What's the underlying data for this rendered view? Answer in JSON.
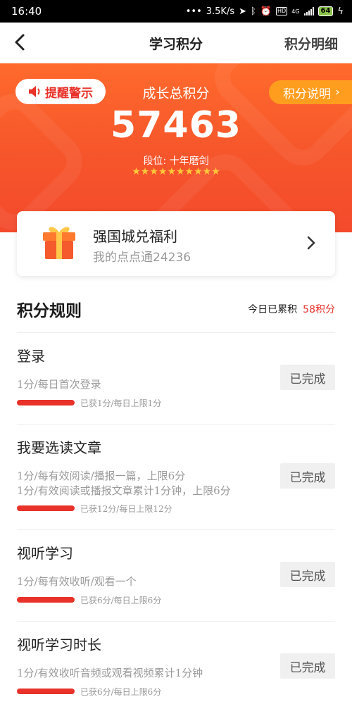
{
  "status_bar": {
    "time": "16:40",
    "network_speed": "3.5K/s",
    "hd": "HD",
    "network_type": "4G",
    "battery": "64"
  },
  "nav": {
    "title": "学习积分",
    "detail_link": "积分明细"
  },
  "hero": {
    "warning_button": "提醒警示",
    "explain_button": "积分说明",
    "growth_label": "成长总积分",
    "total_score": "57463",
    "rank_label": "段位: 十年磨剑",
    "stars": "★★★★★★★★★★",
    "colors": {
      "hero": "#f6552b",
      "accent": "#ff9d1e",
      "star": "#ffc93a"
    }
  },
  "benefit": {
    "title": "强国城兑福利",
    "subtitle": "我的点点通24236"
  },
  "rules": {
    "title": "积分规则",
    "today_label": "今日已累积",
    "today_points": "58积分",
    "items": [
      {
        "name": "登录",
        "desc": [
          "1分/每日首次登录"
        ],
        "progress": "已获1分/每日上限1分",
        "button": "已完成"
      },
      {
        "name": "我要选读文章",
        "desc": [
          "1分/每有效阅读/播报一篇，上限6分",
          "1分/有效阅读或播报文章累计1分钟，上限6分"
        ],
        "progress": "已获12分/每日上限12分",
        "button": "已完成"
      },
      {
        "name": "视听学习",
        "desc": [
          "1分/每有效收听/观看一个"
        ],
        "progress": "已获6分/每日上限6分",
        "button": "已完成"
      },
      {
        "name": "视听学习时长",
        "desc": [
          "1分/有效收听音频或观看视频累计1分钟"
        ],
        "progress": "已获6分/每日上限6分",
        "button": "已完成"
      }
    ]
  }
}
